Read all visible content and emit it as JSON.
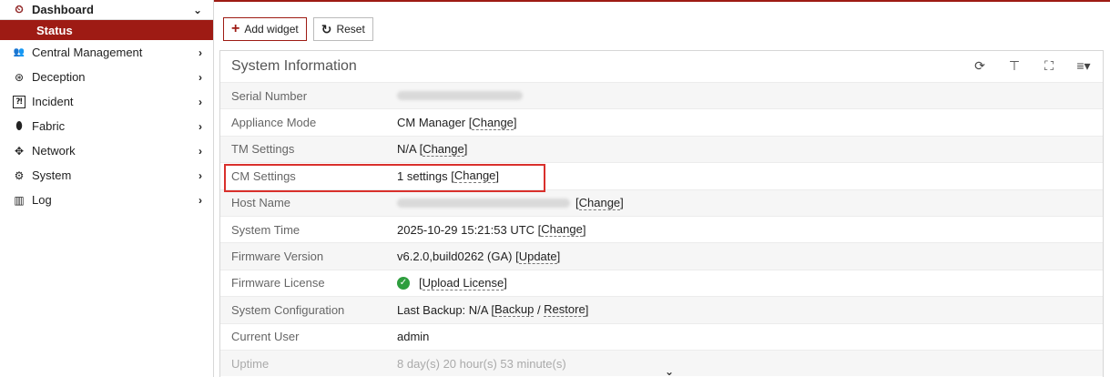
{
  "sidebar": {
    "items": [
      {
        "label": "Dashboard",
        "icon": "dashboard-icon",
        "glyph": "⏲",
        "chevron": "⌄"
      },
      {
        "label": "Central Management",
        "icon": "users-icon",
        "glyph": "👥",
        "chevron": "›"
      },
      {
        "label": "Deception",
        "icon": "deception-icon",
        "glyph": "⊛",
        "chevron": "›"
      },
      {
        "label": "Incident",
        "icon": "incident-icon",
        "glyph": "⁈",
        "chevron": "›"
      },
      {
        "label": "Fabric",
        "icon": "fabric-icon",
        "glyph": "⬮",
        "chevron": "›"
      },
      {
        "label": "Network",
        "icon": "network-icon",
        "glyph": "✥",
        "chevron": "›"
      },
      {
        "label": "System",
        "icon": "gear-icon",
        "glyph": "⚙",
        "chevron": "›"
      },
      {
        "label": "Log",
        "icon": "chart-icon",
        "glyph": "▥",
        "chevron": "›"
      }
    ],
    "sub_active": "Status"
  },
  "toolbar": {
    "add_widget": "Add widget",
    "reset": "Reset"
  },
  "panel": {
    "title": "System Information",
    "rows": [
      {
        "label": "Serial Number",
        "value": ""
      },
      {
        "label": "Appliance Mode",
        "value": "CM Manager [",
        "link": "Change",
        "suffix": "]"
      },
      {
        "label": "TM Settings",
        "value": "N/A [",
        "link": "Change",
        "suffix": "]"
      },
      {
        "label": "CM Settings",
        "value": "1 settings [",
        "link": "Change",
        "suffix": "]"
      },
      {
        "label": "Host Name",
        "value": "",
        "link": "Change",
        "suffix": "]"
      },
      {
        "label": "System Time",
        "value": "2025-10-29 15:21:53 UTC [",
        "link": "Change",
        "suffix": "]"
      },
      {
        "label": "Firmware Version",
        "value": "v6.2.0,build0262 (GA) [",
        "link": "Update",
        "suffix": "]"
      },
      {
        "label": "Firmware License",
        "value": "[",
        "link": "Upload License",
        "suffix": "]"
      },
      {
        "label": "System Configuration",
        "value": "Last Backup: N/A [",
        "link": "Backup",
        "sep": " / ",
        "link2": "Restore",
        "suffix": "]"
      },
      {
        "label": "Current User",
        "value": "admin"
      },
      {
        "label": "Uptime",
        "value": "8 day(s) 20 hour(s) 53 minute(s)"
      }
    ]
  },
  "colors": {
    "brand": "#9e1b14",
    "highlight": "#d9302c",
    "success": "#2e9e3e"
  }
}
